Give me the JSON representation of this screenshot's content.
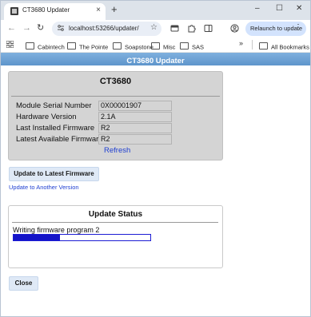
{
  "browser": {
    "tab_title": "CT3680 Updater",
    "tab_close": "×",
    "new_tab": "+",
    "win_minimize": "–",
    "win_maximize": "☐",
    "win_close": "✕",
    "back": "←",
    "forward": "→",
    "reload": "↻",
    "url": "localhost:53266/updater/",
    "star": "☆",
    "relaunch_label": "Relaunch to update",
    "relaunch_menu": "⋮"
  },
  "bookmarks": {
    "items": [
      "Cabintech",
      "The Pointe",
      "Soapstone",
      "Misc",
      "SAS"
    ],
    "more": "»",
    "all_bookmarks": "All Bookmarks"
  },
  "app": {
    "header_title": "CT3680 Updater",
    "panel_title": "CT3680",
    "rows": [
      {
        "label": "Module Serial Number",
        "value": "0X00001907"
      },
      {
        "label": "Hardware Version",
        "value": "2.1A"
      },
      {
        "label": "Last Installed Firmware",
        "value": "R2"
      },
      {
        "label": "Latest Available Firmware",
        "value": "R2"
      }
    ],
    "refresh_label": "Refresh",
    "update_latest_label": "Update to Latest Firmware",
    "update_another_label": "Update to Another Version",
    "status_title": "Update Status",
    "status_message": "Writing firmware program 2",
    "progress": 0.34,
    "close_label": "Close"
  },
  "colors": {
    "header_blue": "#6ea3d6",
    "progress_blue": "#1414c8",
    "link_blue": "#1f3fd1",
    "panel_gray": "#d4d4d4",
    "button_bg": "#dfe9f6"
  }
}
